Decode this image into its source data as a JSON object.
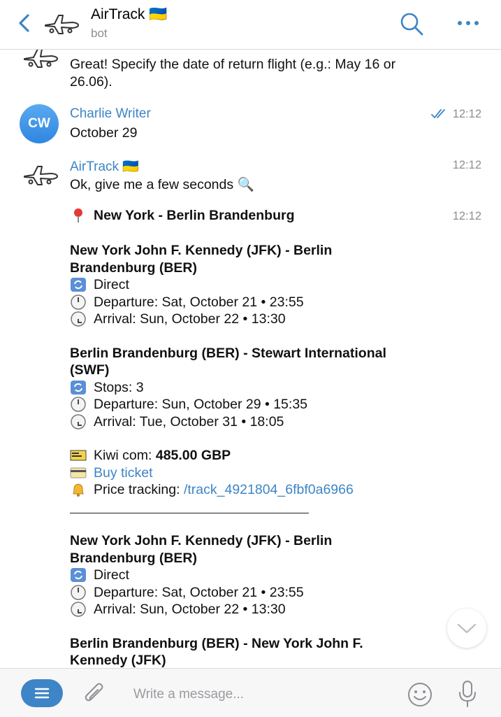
{
  "header": {
    "title": "AirTrack 🇺🇦",
    "subtitle": "bot"
  },
  "messages": {
    "m1_text": "Great! Specify the date of return flight (e.g.: May 16 or 26.06).",
    "m2_sender": "Charlie Writer",
    "m2_avatar": "CW",
    "m2_text": "October 29",
    "m2_time": "12:12",
    "m3_sender": "AirTrack 🇺🇦",
    "m3_text": "Ok, give me a few seconds 🔍",
    "m3_time": "12:12",
    "m4_time": "12:12",
    "m4_route": "New York - Berlin Brandenburg",
    "option1": {
      "leg1_title": "New York John F. Kennedy (JFK) - Berlin Brandenburg (BER)",
      "leg1_stops": "Direct",
      "leg1_departure": "Departure: Sat, October 21 • 23:55",
      "leg1_arrival": "Arrival: Sun, October 22 • 13:30",
      "leg2_title": "Berlin Brandenburg (BER) - Stewart International (SWF)",
      "leg2_stops": "Stops: 3",
      "leg2_departure": "Departure: Sun, October 29 • 15:35",
      "leg2_arrival": "Arrival: Tue, October 31 • 18:05",
      "agency": "Kiwi com: ",
      "price": "485.00 GBP",
      "buy": "Buy ticket",
      "tracking_label": "Price tracking: ",
      "tracking_cmd": "/track_4921804_6fbf0a6966"
    },
    "option2": {
      "leg1_title": "New York John F. Kennedy (JFK) - Berlin Brandenburg (BER)",
      "leg1_stops": "Direct",
      "leg1_departure": "Departure: Sat, October 21 • 23:55",
      "leg1_arrival": "Arrival: Sun, October 22 • 13:30",
      "leg2_title": "Berlin Brandenburg (BER) - New York John F. Kennedy (JFK)"
    }
  },
  "input": {
    "placeholder": "Write a message..."
  },
  "colors": {
    "accent": "#3d85c6",
    "muted": "#8e8e93"
  }
}
